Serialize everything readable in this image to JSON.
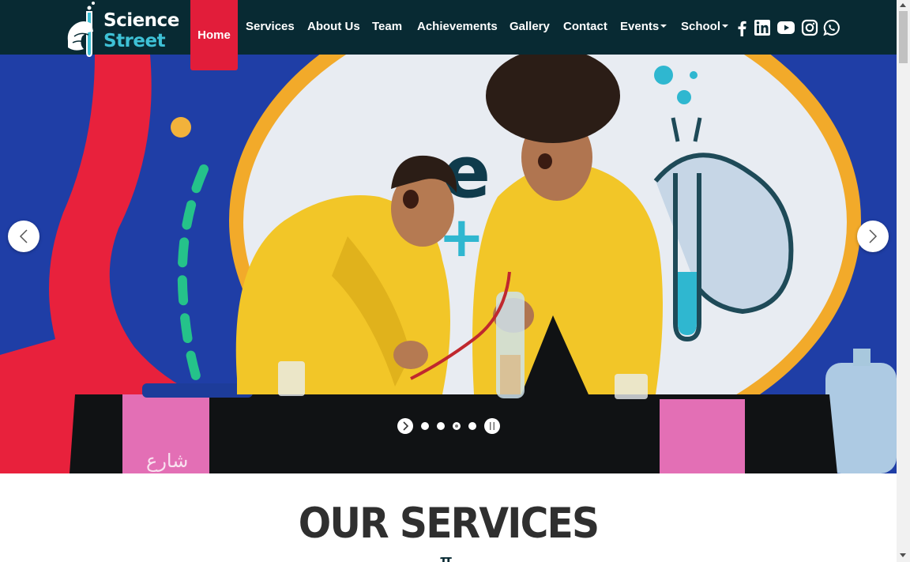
{
  "brand": {
    "line1": "Science",
    "line2": "Street",
    "primary_color": "#082a33",
    "accent_color": "#e21d3a",
    "logo_accent": "#3ec1d6"
  },
  "nav": {
    "home": "Home",
    "items": [
      "Services",
      "About Us",
      "Team",
      "Achievements",
      "Gallery",
      "Contact",
      "Events",
      "School"
    ],
    "social_icons": [
      "facebook-icon",
      "linkedin-icon",
      "youtube-icon",
      "instagram-icon",
      "whatsapp-icon"
    ]
  },
  "slider": {
    "slide_count": 4,
    "active_index": 2,
    "controls": [
      "prev-arrow",
      "next-arrow",
      "play-button",
      "pause-button"
    ]
  },
  "services": {
    "title": "OUR SERVICES"
  }
}
